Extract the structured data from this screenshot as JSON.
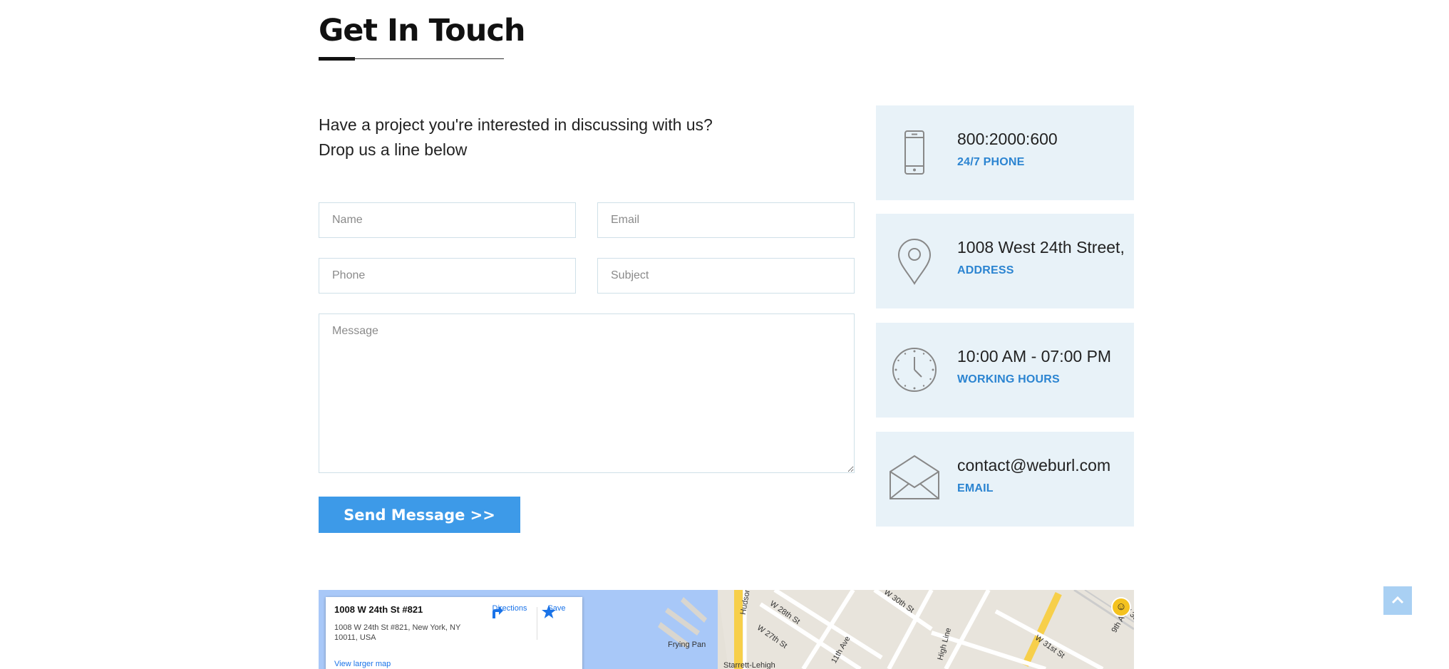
{
  "heading": "Get In Touch",
  "intro": {
    "line1": "Have a project you're interested in discussing with us?",
    "line2": "Drop us a line below"
  },
  "form": {
    "name_placeholder": "Name",
    "email_placeholder": "Email",
    "phone_placeholder": "Phone",
    "subject_placeholder": "Subject",
    "message_placeholder": "Message",
    "send_label": "Send Message >>"
  },
  "contact": [
    {
      "value": "800:2000:600",
      "label": "24/7 PHONE",
      "icon": "smartphone-icon"
    },
    {
      "value": "1008 West 24th Street,",
      "label": "ADDRESS",
      "icon": "map-pin-icon"
    },
    {
      "value": "10:00 AM - 07:00 PM",
      "label": "WORKING HOURS",
      "icon": "clock-icon"
    },
    {
      "value": "contact@weburl.com",
      "label": "EMAIL",
      "icon": "envelope-icon"
    }
  ],
  "map": {
    "place_title": "1008 W 24th St #821",
    "place_address": "1008 W 24th St #821, New York, NY 10011, USA",
    "directions_label": "Directions",
    "save_label": "Save",
    "larger_map_label": "View larger map",
    "labels": [
      "W 28th St",
      "W 27th St",
      "W 30th St",
      "W 31st St",
      "11th Ave",
      "Frying Pan",
      "Starrett-Lehigh",
      "Hudson",
      "High Line",
      "9th Av",
      "W 33r"
    ]
  },
  "colors": {
    "accent": "#3d9ae8",
    "label_blue": "#2b84d1",
    "card_bg": "#e8f2f8",
    "input_border": "#cfe0e8",
    "scroll_top": "#a9d0f3"
  }
}
